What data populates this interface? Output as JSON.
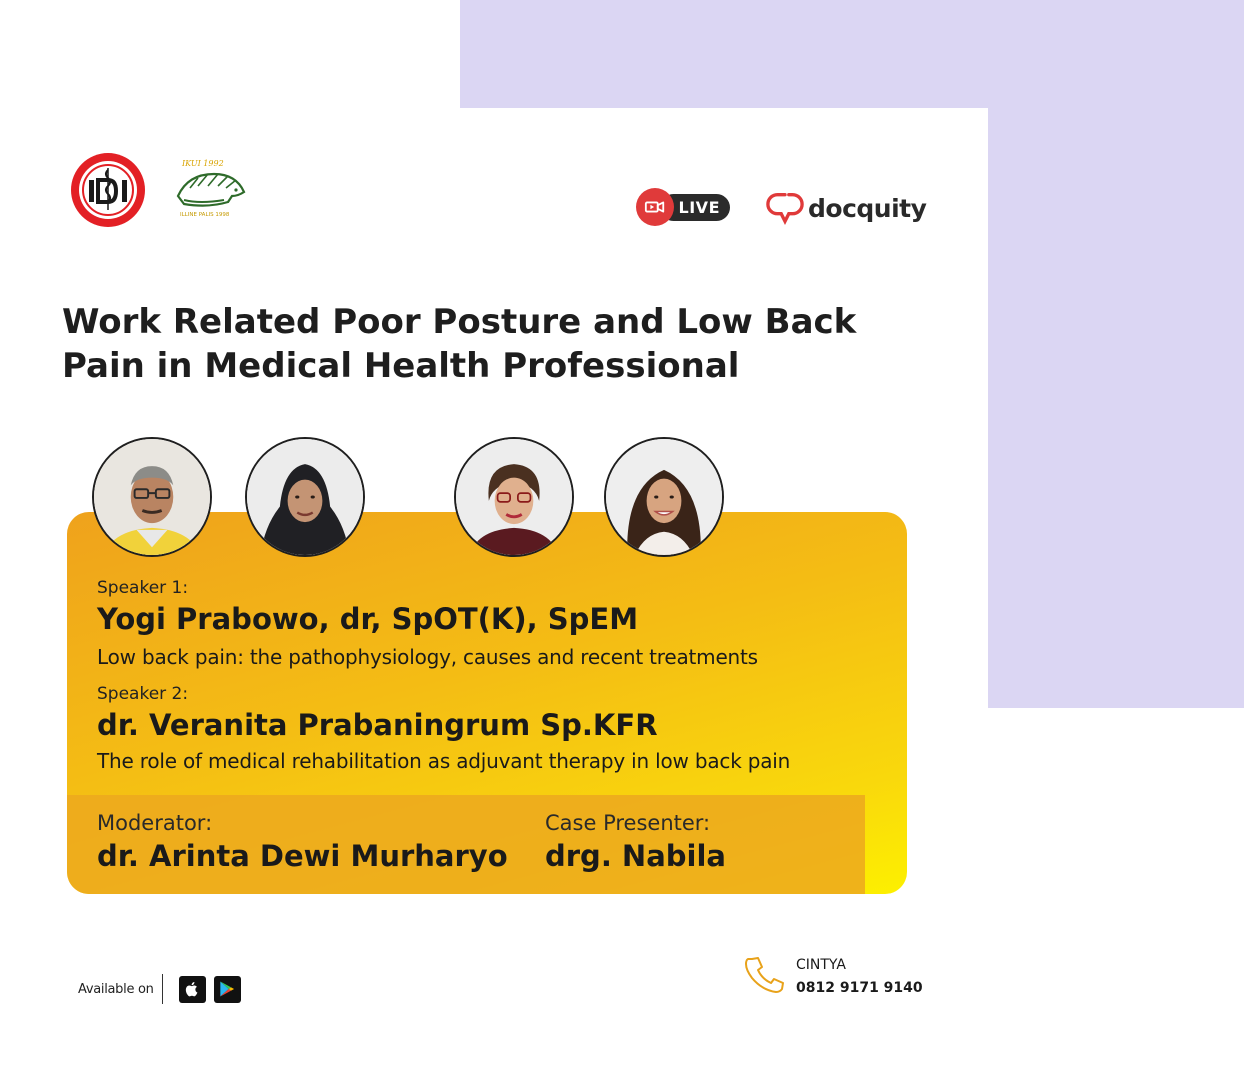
{
  "colors": {
    "lavender": "#dbd6f3",
    "card_top": "#efa21c",
    "card_bottom": "#fdf000",
    "live_red": "#e03a3a",
    "docquity_red": "#e03a3a"
  },
  "header": {
    "logo_left": "IDI",
    "logo_mid_top": "IKUI 1992",
    "logo_mid_bottom": "ILLINE PALIS 1998",
    "live_label": "LIVE",
    "brand": "docquity"
  },
  "title": "Work Related Poor Posture and Low Back Pain in Medical Health Professional",
  "speakers": [
    {
      "role": "Speaker 1:",
      "name": "Yogi Prabowo, dr, SpOT(K), SpEM",
      "topic": "Low back pain: the pathophysiology, causes and recent treatments"
    },
    {
      "role": "Speaker 2:",
      "name": "dr. Veranita Prabaningrum Sp.KFR",
      "topic": "The role of medical rehabilitation as adjuvant therapy in low back pain"
    }
  ],
  "moderator": {
    "role": "Moderator:",
    "name": "dr. Arinta Dewi Murharyo"
  },
  "case_presenter": {
    "role": "Case Presenter:",
    "name": "drg. Nabila"
  },
  "footer": {
    "available_on": "Available on",
    "stores": [
      "apple-icon",
      "google-play-icon"
    ],
    "contact_name": "CINTYA",
    "contact_phone": "0812 9171 9140"
  }
}
